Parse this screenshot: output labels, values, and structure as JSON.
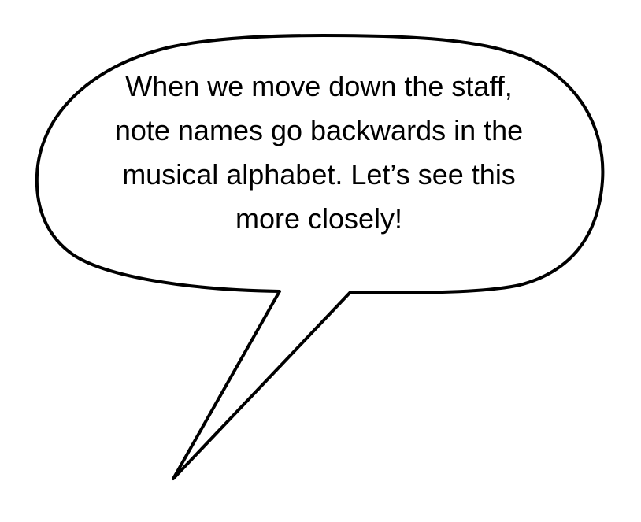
{
  "speech_bubble": {
    "lines": [
      "When we move down the staff,",
      "note names go backwards in the",
      "musical alphabet. Let’s see this",
      "more closely!"
    ]
  },
  "colors": {
    "background": "#ffffff",
    "outline": "#000000",
    "text": "#000000"
  }
}
